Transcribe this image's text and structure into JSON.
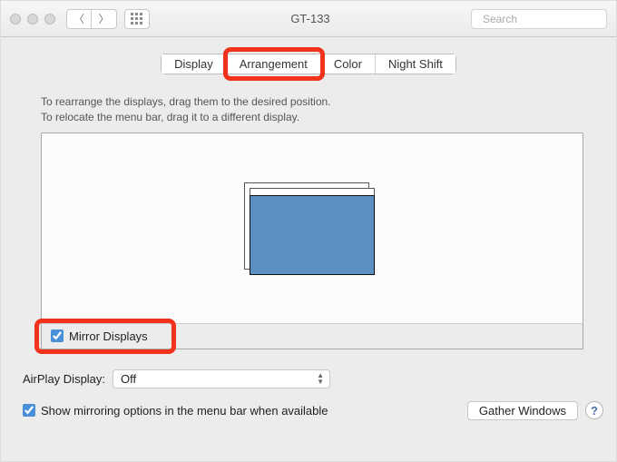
{
  "window": {
    "title": "GT-133"
  },
  "search": {
    "placeholder": "Search"
  },
  "tabs": {
    "display": "Display",
    "arrangement": "Arrangement",
    "color": "Color",
    "nightshift": "Night Shift"
  },
  "instructions": {
    "line1": "To rearrange the displays, drag them to the desired position.",
    "line2": "To relocate the menu bar, drag it to a different display."
  },
  "mirror": {
    "label": "Mirror Displays",
    "checked": true
  },
  "airplay": {
    "label": "AirPlay Display:",
    "value": "Off"
  },
  "bottom": {
    "show_mirroring": "Show mirroring options in the menu bar when available",
    "checked": true
  },
  "buttons": {
    "gather": "Gather Windows"
  },
  "help": {
    "label": "?"
  }
}
